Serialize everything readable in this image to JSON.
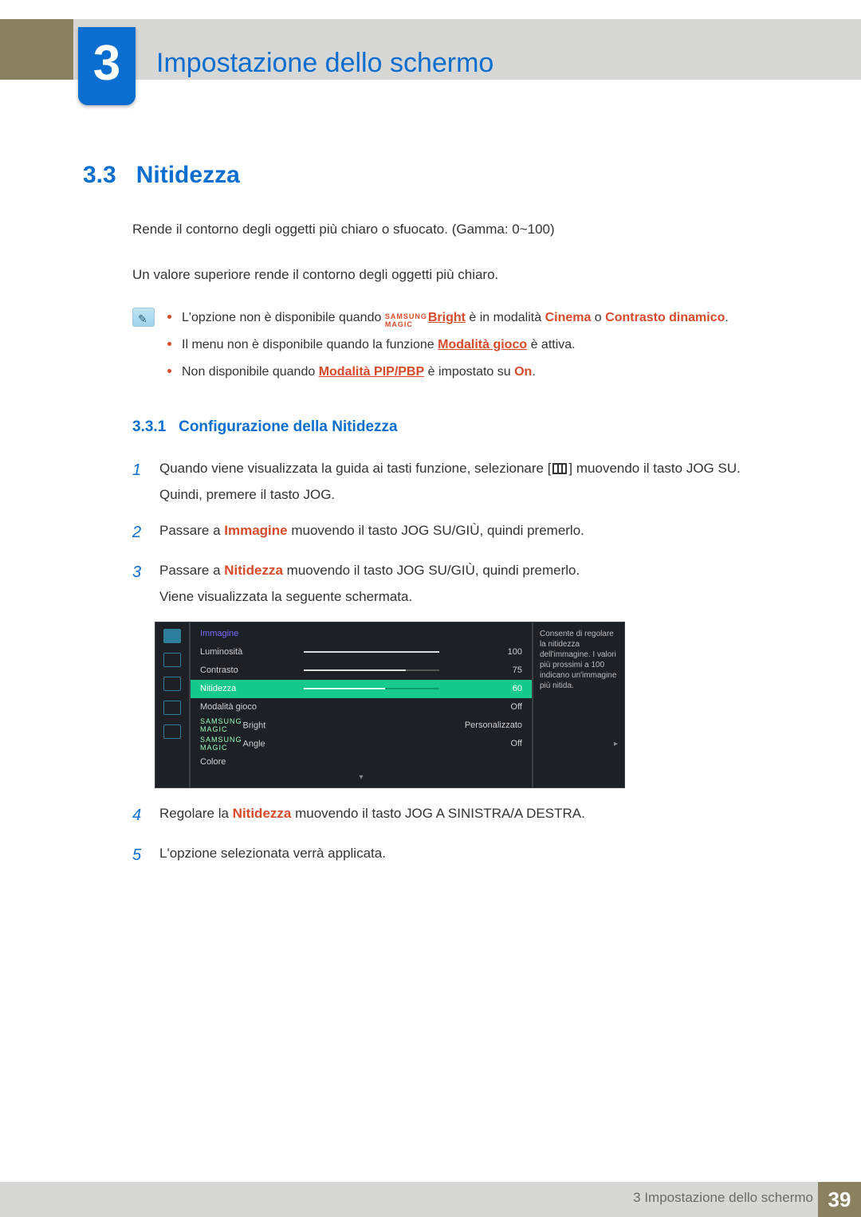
{
  "chapter": {
    "number": "3",
    "title": "Impostazione dello schermo"
  },
  "section": {
    "number": "3.3",
    "title": "Nitidezza",
    "p1": "Rende il contorno degli oggetti più chiaro o sfuocato. (Gamma: 0~100)",
    "p2": "Un valore superiore rende il contorno degli oggetti più chiaro."
  },
  "info": {
    "brand_l1": "SAMSUNG",
    "brand_l2": "MAGIC",
    "bright_suffix": "Bright",
    "b1_a": "L'opzione non è disponibile quando ",
    "b1_b": " è in modalità ",
    "b1_cinema": "Cinema",
    "b1_or": " o ",
    "b1_dyn": "Contrasto dinamico",
    "b1_end": ".",
    "b2_a": "Il menu non è disponibile quando la funzione ",
    "b2_mode": "Modalità gioco",
    "b2_b": " è attiva.",
    "b3_a": "Non disponibile quando ",
    "b3_mode": "Modalità PIP/PBP",
    "b3_b": " è impostato su ",
    "b3_on": "On",
    "b3_end": "."
  },
  "subsection": {
    "number": "3.3.1",
    "title": "Configurazione della Nitidezza"
  },
  "steps": {
    "s1_num": "1",
    "s1_a": "Quando viene visualizzata la guida ai tasti funzione, selezionare [",
    "s1_b": "] muovendo il tasto JOG SU.",
    "s1_sub": "Quindi, premere il tasto JOG.",
    "s2_num": "2",
    "s2_a": "Passare a ",
    "s2_target": "Immagine",
    "s2_b": " muovendo il tasto JOG SU/GIÙ, quindi premerlo.",
    "s3_num": "3",
    "s3_a": "Passare a ",
    "s3_target": "Nitidezza",
    "s3_b": " muovendo il tasto JOG SU/GIÙ, quindi premerlo.",
    "s3_sub": "Viene visualizzata la seguente schermata.",
    "s4_num": "4",
    "s4_a": "Regolare la ",
    "s4_target": "Nitidezza",
    "s4_b": " muovendo il tasto JOG A SINISTRA/A DESTRA.",
    "s5_num": "5",
    "s5_a": "L'opzione selezionata verrà applicata."
  },
  "osd": {
    "head": "Immagine",
    "side": "Consente di regolare la nitidezza dell'immagine. I valori più prossimi a 100 indicano un'immagine più nitida.",
    "rows": [
      {
        "label": "Luminosità",
        "value": "100",
        "bar": 100,
        "selected": false
      },
      {
        "label": "Contrasto",
        "value": "75",
        "bar": 75,
        "selected": false
      },
      {
        "label": "Nitidezza",
        "value": "60",
        "bar": 60,
        "selected": true
      },
      {
        "label": "Modalità gioco",
        "value": "Off",
        "bar": null,
        "selected": false
      },
      {
        "label": "MAGICBright",
        "brand": true,
        "value": "Personalizzato",
        "bar": null,
        "selected": false
      },
      {
        "label": "MAGICAngle",
        "brand": true,
        "value": "Off",
        "bar": null,
        "selected": false
      },
      {
        "label": "Colore",
        "value": "",
        "bar": null,
        "selected": false
      }
    ]
  },
  "footer": {
    "label": "3 Impostazione dello schermo",
    "page": "39"
  }
}
